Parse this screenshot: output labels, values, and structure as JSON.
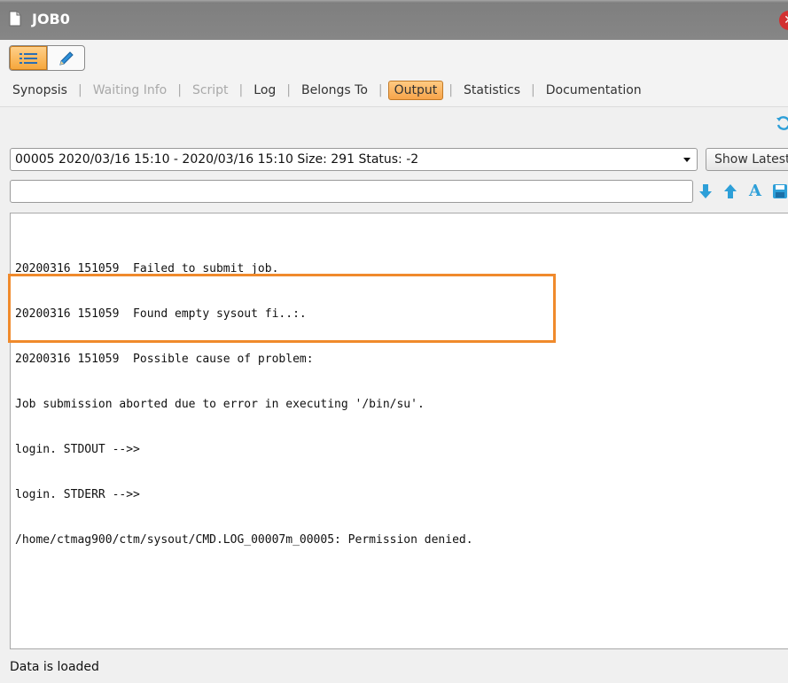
{
  "window": {
    "title": "JOB0"
  },
  "toolbar": {
    "tabs": [
      {
        "label": "Synopsis",
        "state": "normal"
      },
      {
        "label": "Waiting Info",
        "state": "disabled"
      },
      {
        "label": "Script",
        "state": "disabled"
      },
      {
        "label": "Log",
        "state": "normal"
      },
      {
        "label": "Belongs To",
        "state": "normal"
      },
      {
        "label": "Output",
        "state": "active"
      },
      {
        "label": "Statistics",
        "state": "normal"
      },
      {
        "label": "Documentation",
        "state": "normal"
      }
    ],
    "separator": "|"
  },
  "output": {
    "selected_run": "00005 2020/03/16 15:10 - 2020/03/16 15:10 Size: 291 Status: -2",
    "show_latest_label": "Show Latest",
    "search_value": "",
    "lines": [
      "20200316 151059  Failed to submit job.",
      "20200316 151059  Found empty sysout fi..:.",
      "20200316 151059  Possible cause of problem:",
      "Job submission aborted due to error in executing '/bin/su'.",
      "login. STDOUT -->>",
      "login. STDERR -->>",
      "/home/ctmag900/ctm/sysout/CMD.LOG_00007m_00005: Permission denied."
    ]
  },
  "status": {
    "message": "Data is loaded"
  },
  "colors": {
    "accent": "#f7a44a",
    "highlight": "#f08a2c",
    "icon_blue": "#2d9fd8"
  }
}
